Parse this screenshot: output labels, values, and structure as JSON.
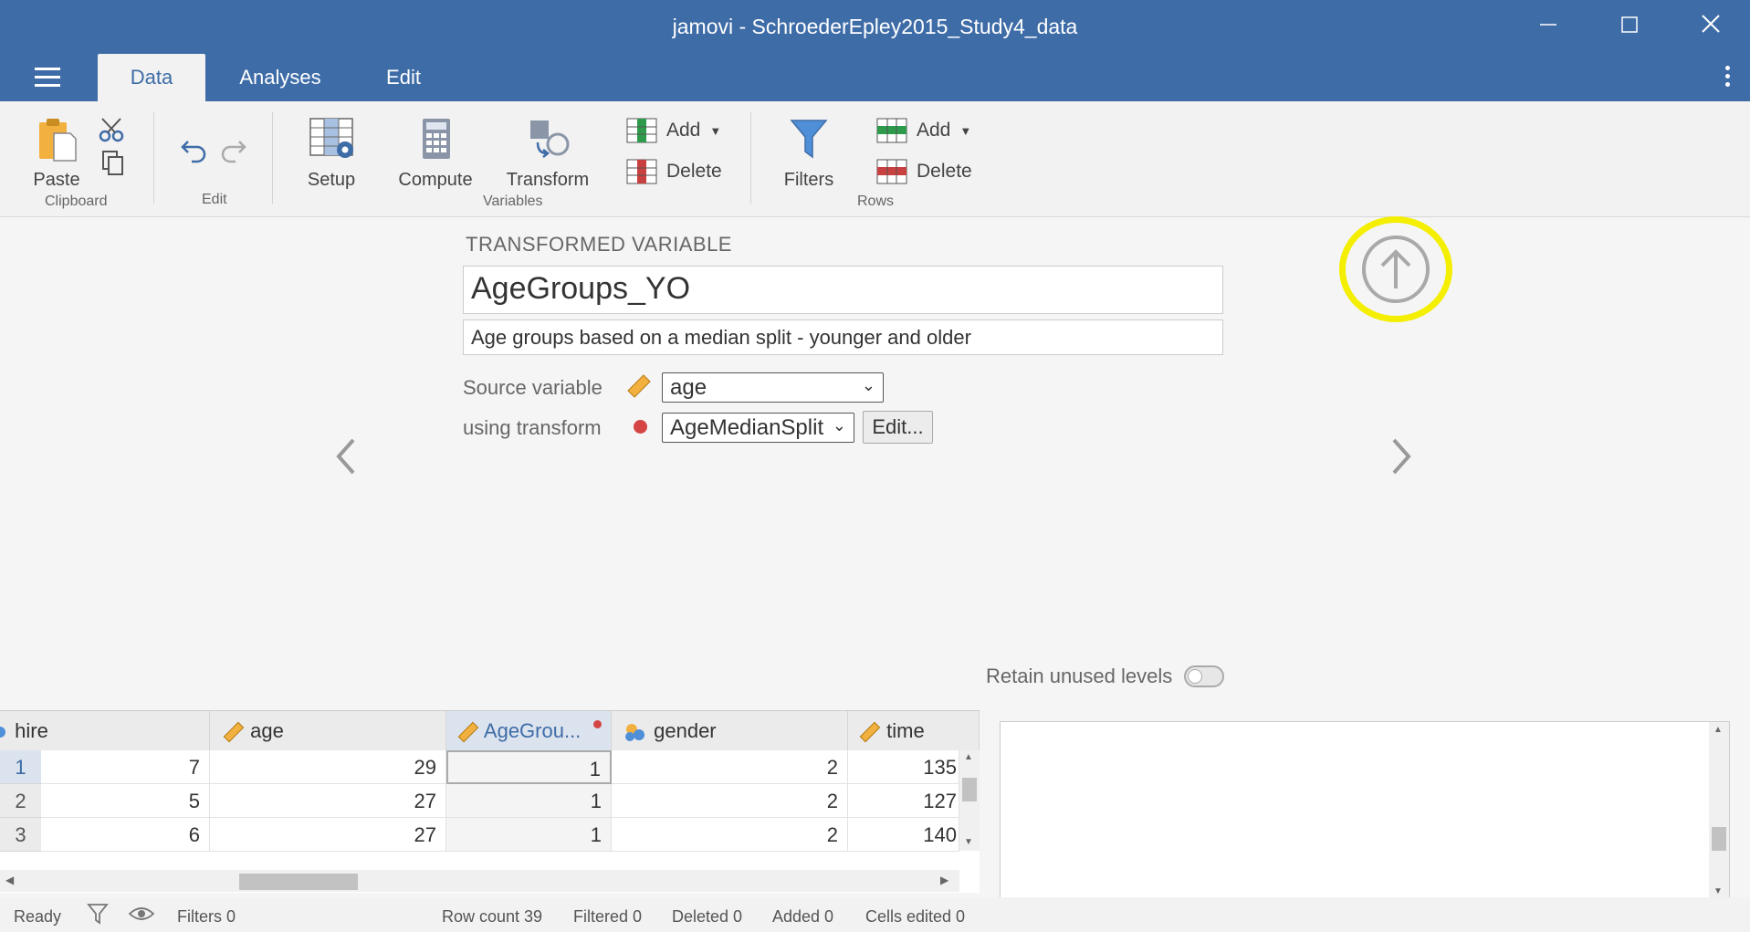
{
  "window": {
    "title": "jamovi - SchroederEpley2015_Study4_data"
  },
  "tabs": [
    {
      "label": "Data"
    },
    {
      "label": "Analyses"
    },
    {
      "label": "Edit"
    }
  ],
  "ribbon": {
    "paste": "Paste",
    "clipboard_group": "Clipboard",
    "edit_group": "Edit",
    "setup": "Setup",
    "compute": "Compute",
    "transform": "Transform",
    "var_add": "Add",
    "var_delete": "Delete",
    "variables_group": "Variables",
    "filters": "Filters",
    "row_add": "Add",
    "row_delete": "Delete",
    "rows_group": "Rows"
  },
  "editor": {
    "section_title": "TRANSFORMED VARIABLE",
    "name": "AgeGroups_YO",
    "description": "Age groups based on a median split - younger and older",
    "source_label": "Source variable",
    "source_value": "age",
    "transform_label": "using transform",
    "transform_value": "AgeMedianSplit",
    "edit_button": "Edit...",
    "retain_label": "Retain unused levels"
  },
  "grid": {
    "columns": [
      "hire",
      "age",
      "AgeGrou...",
      "gender",
      "time"
    ],
    "rows": [
      {
        "num": "1",
        "cells": [
          "7",
          "29",
          "1",
          "2",
          "135"
        ]
      },
      {
        "num": "2",
        "cells": [
          "5",
          "27",
          "1",
          "2",
          "127"
        ]
      },
      {
        "num": "3",
        "cells": [
          "6",
          "27",
          "1",
          "2",
          "140"
        ]
      }
    ]
  },
  "status": {
    "ready": "Ready",
    "filters": "Filters 0",
    "row_count": "Row count 39",
    "filtered": "Filtered 0",
    "deleted": "Deleted 0",
    "added": "Added 0",
    "cells_edited": "Cells edited 0"
  },
  "colors": {
    "brand": "#3e6ca7",
    "highlight": "#f4ee00",
    "transform_dot": "#d64545"
  }
}
